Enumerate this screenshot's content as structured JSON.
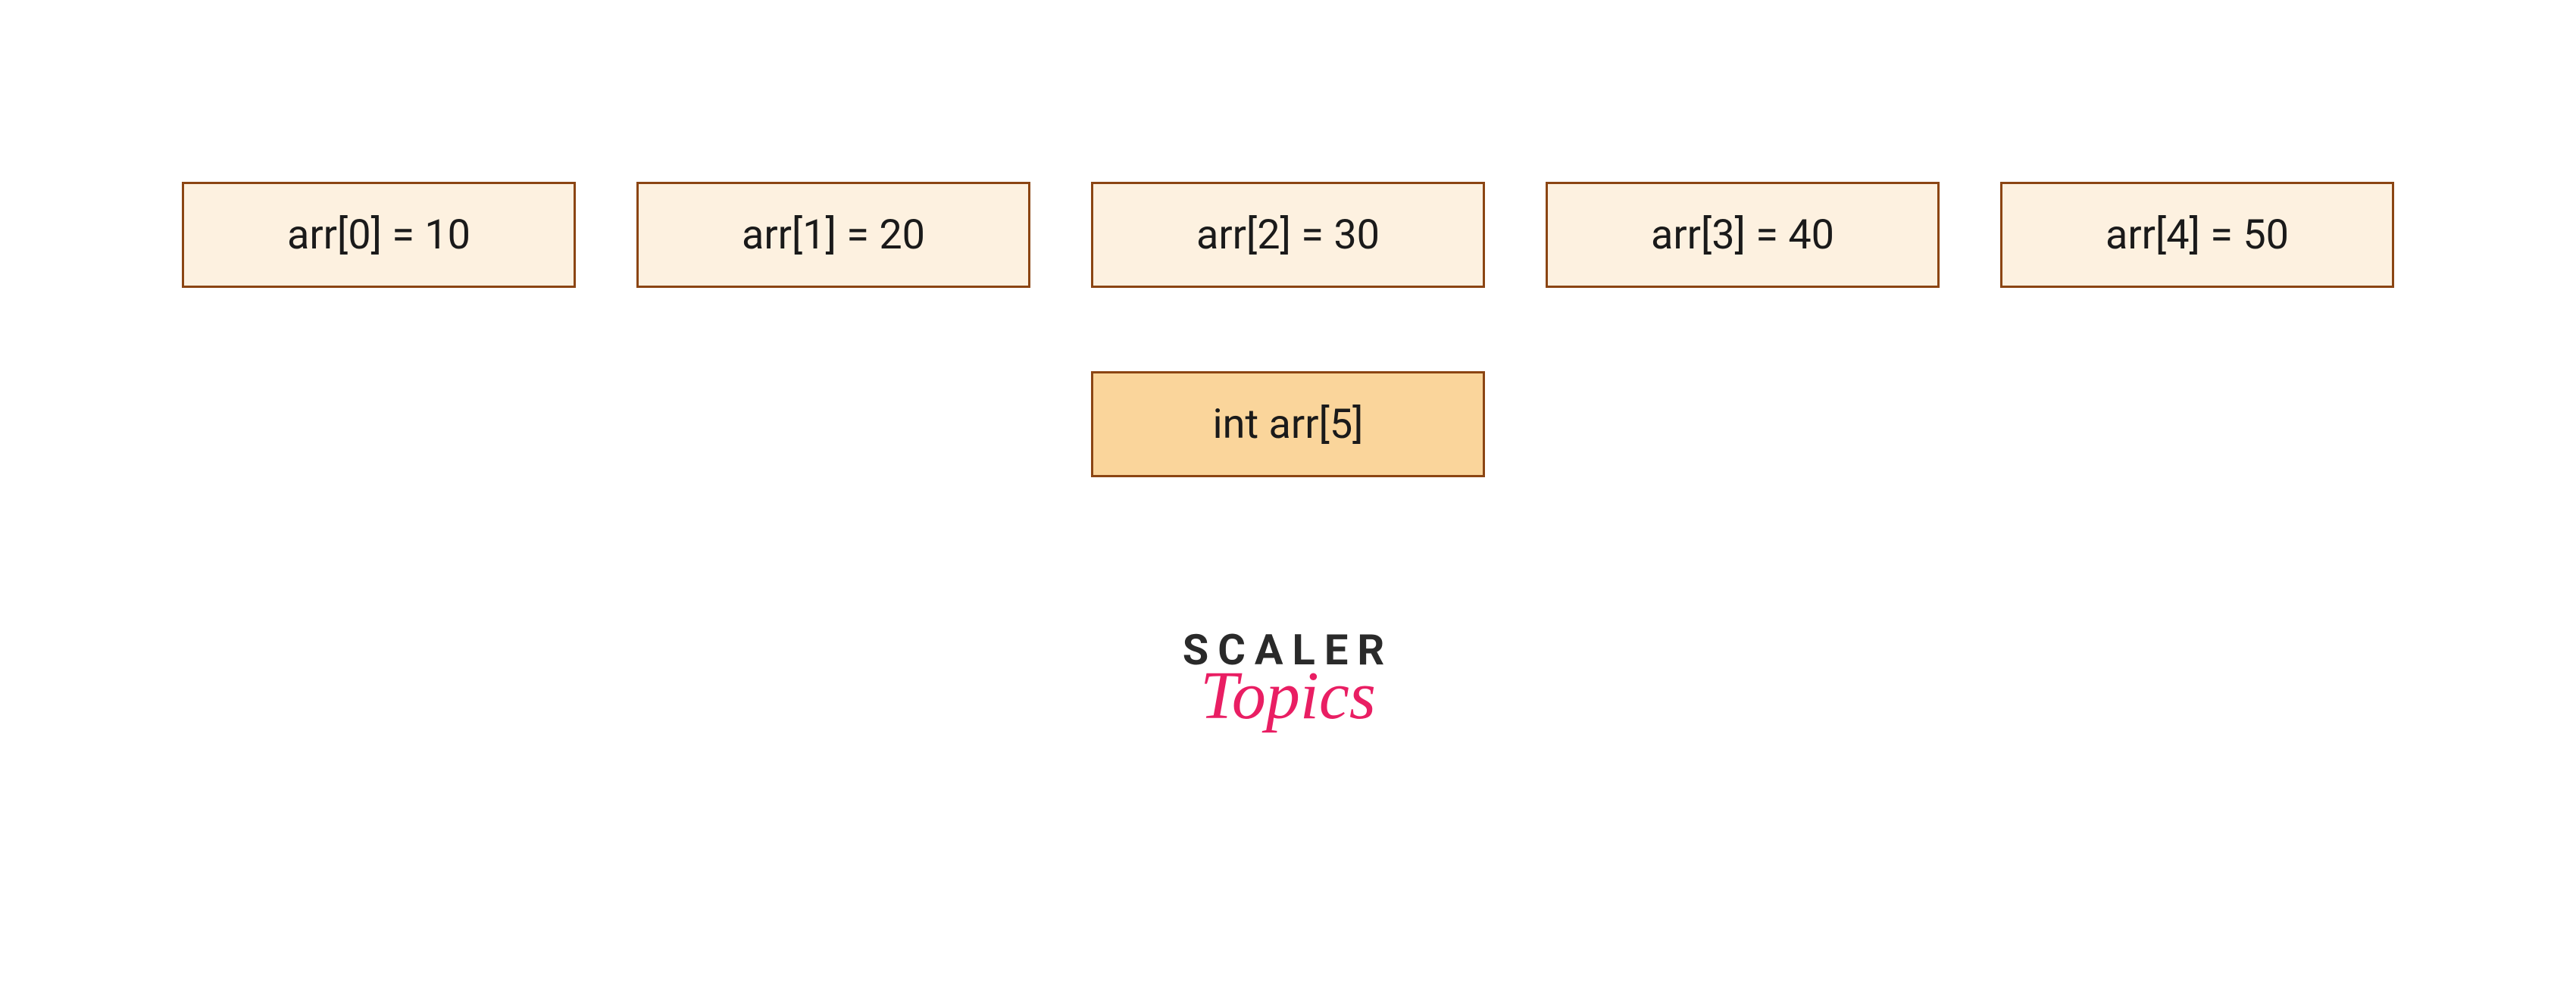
{
  "array": {
    "cells": [
      "arr[0] = 10",
      "arr[1] = 20",
      "arr[2] = 30",
      "arr[3] = 40",
      "arr[4] = 50"
    ],
    "declaration": "int arr[5]"
  },
  "logo": {
    "line1": "SCALER",
    "line2": "Topics"
  }
}
